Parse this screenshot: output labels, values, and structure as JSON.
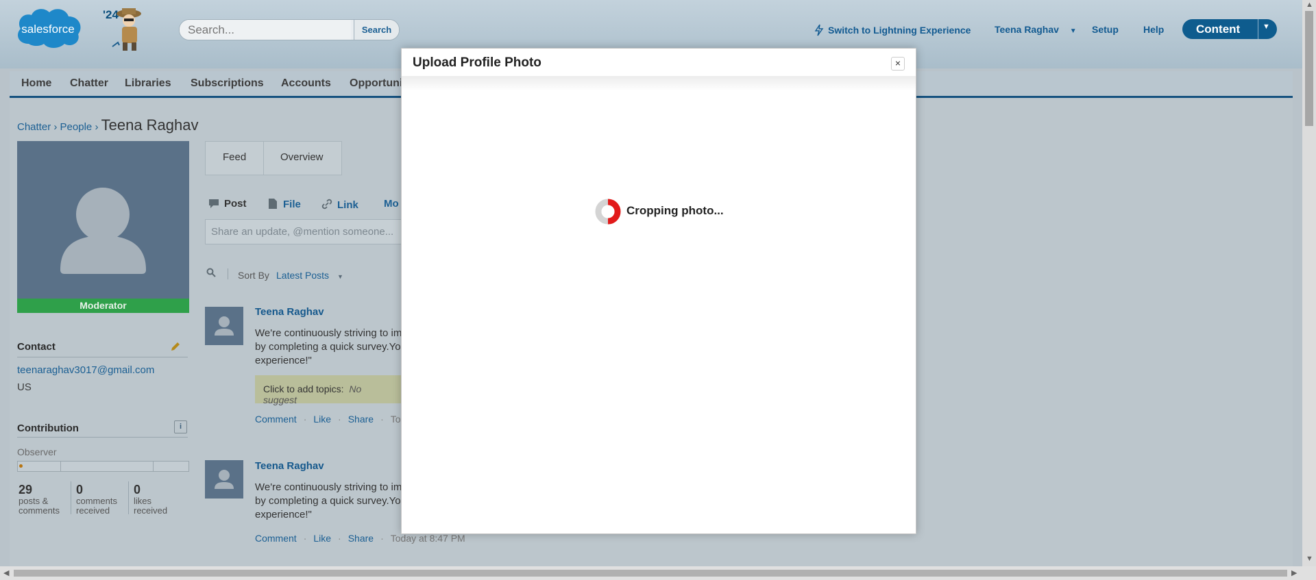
{
  "header": {
    "logo_text": "salesforce",
    "year_badge": "'24",
    "search_placeholder": "Search...",
    "search_button": "Search",
    "switch_lightning": "Switch to Lightning Experience",
    "user_name": "Teena Raghav",
    "setup": "Setup",
    "help": "Help",
    "content_button": "Content"
  },
  "tabs": [
    "Home",
    "Chatter",
    "Libraries",
    "Subscriptions",
    "Accounts",
    "Opportuni"
  ],
  "breadcrumb": {
    "chatter": "Chatter",
    "people": "People",
    "sep": "›",
    "current": "Teena Raghav"
  },
  "profile": {
    "badge": "Moderator",
    "contact_title": "Contact",
    "email": "teenaraghav3017@gmail.com",
    "country": "US",
    "contribution_title": "Contribution",
    "level": "Observer",
    "info_icon": "i",
    "stats": [
      {
        "value": "29",
        "line1": "posts &",
        "line2": "comments"
      },
      {
        "value": "0",
        "line1": "comments",
        "line2": "received"
      },
      {
        "value": "0",
        "line1": "likes",
        "line2": "received"
      }
    ]
  },
  "feed": {
    "tabs": [
      "Feed",
      "Overview"
    ],
    "publisher": {
      "post": "Post",
      "file": "File",
      "link": "Link",
      "more": "Mo"
    },
    "compose_placeholder": "Share an update, @mention someone...",
    "sort_by": "Sort By",
    "sort_value": "Latest Posts",
    "posts": [
      {
        "author": "Teena Raghav",
        "line1": "We're continuously striving to im",
        "line2": "by completing a quick survey.Yo",
        "line3": "experience!\"",
        "topics_label": "Click to add topics:",
        "topics_hint": "No suggest",
        "actions": [
          "Comment",
          "Like",
          "Share"
        ],
        "time": "To"
      },
      {
        "author": "Teena Raghav",
        "line1": "We're continuously striving to im",
        "line2": "by completing a quick survey.Yo",
        "line3": "experience!\"",
        "actions": [
          "Comment",
          "Like",
          "Share"
        ],
        "time": "Today at 8:47 PM"
      }
    ]
  },
  "modal": {
    "title": "Upload Profile Photo",
    "close": "×",
    "status": "Cropping photo..."
  },
  "colors": {
    "brand": "#0e5c8e",
    "moderator": "#2fa04a",
    "spinner": "#e21b1b"
  }
}
